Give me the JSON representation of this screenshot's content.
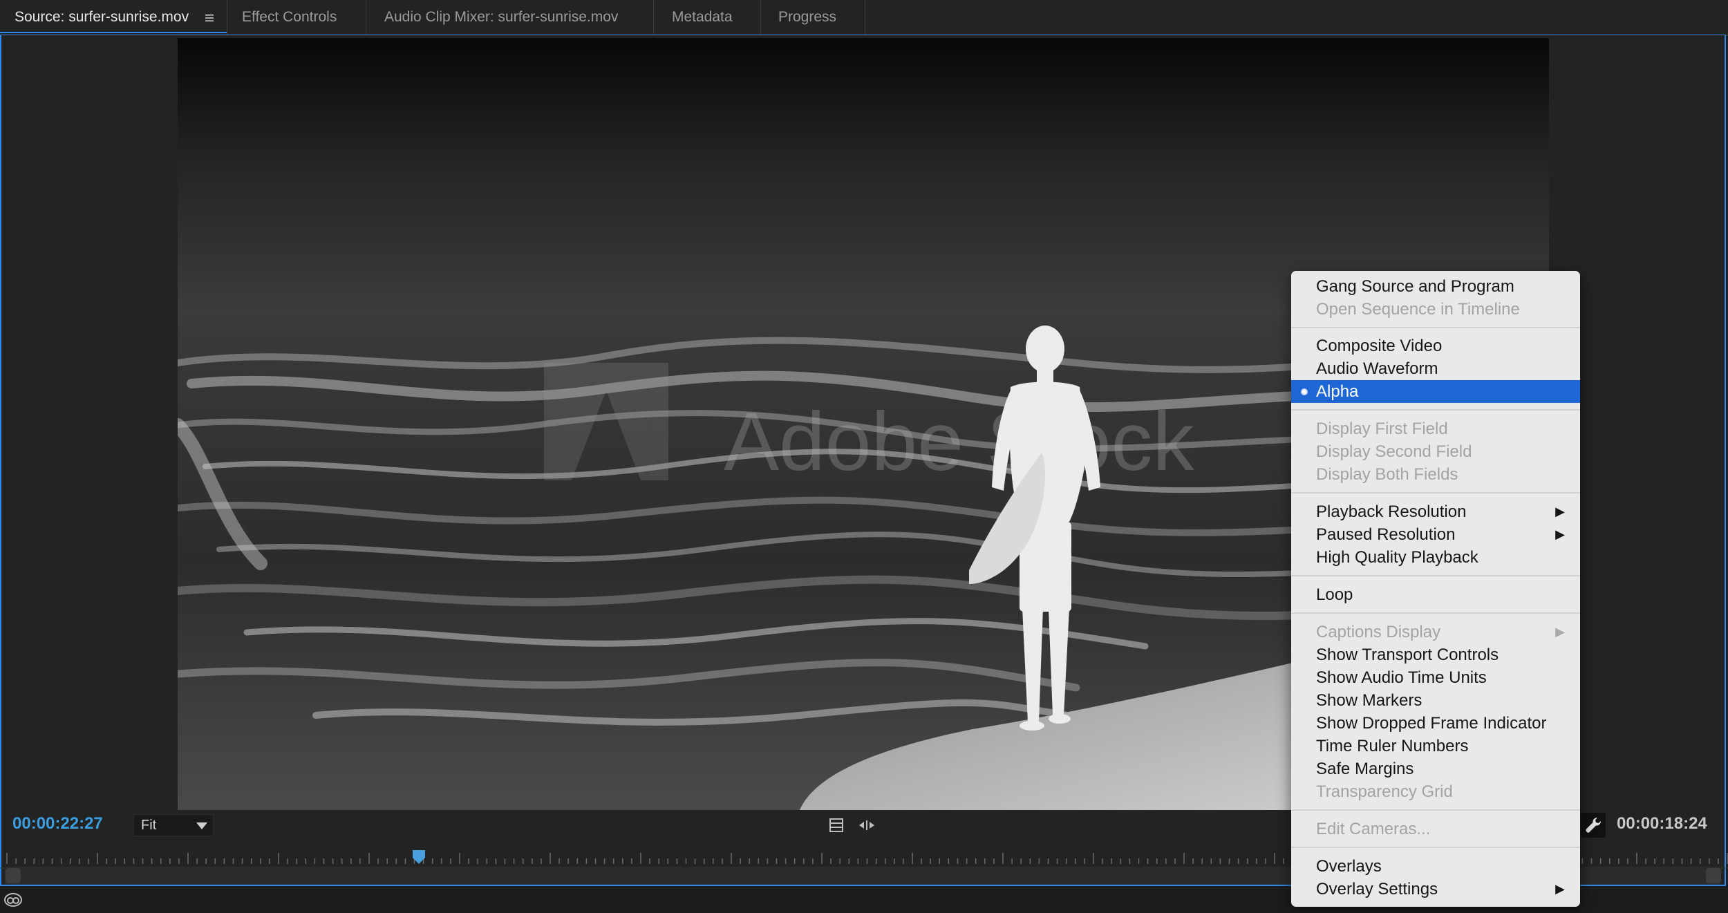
{
  "tabs": [
    {
      "label": "Source: surfer-sunrise.mov",
      "active": true
    },
    {
      "label": "Effect Controls",
      "active": false
    },
    {
      "label": "Audio Clip Mixer: surfer-sunrise.mov",
      "active": false
    },
    {
      "label": "Metadata",
      "active": false
    },
    {
      "label": "Progress",
      "active": false
    }
  ],
  "tab_menu_icon": "hamburger-menu-icon",
  "viewer": {
    "watermark": "Adobe Stock",
    "mode": "Alpha"
  },
  "controls": {
    "current_timecode": "00:00:22:27",
    "duration_timecode": "00:00:18:24",
    "zoom_value": "Fit",
    "icons": [
      "insert-frame-icon",
      "overwrite-arrows-icon",
      "wrench-icon"
    ],
    "playhead_color": "#4a9fde",
    "timecode_color": "#3a9ee0"
  },
  "context_menu": {
    "groups": [
      [
        {
          "label": "Gang Source and Program",
          "disabled": false
        },
        {
          "label": "Open Sequence in Timeline",
          "disabled": true
        }
      ],
      [
        {
          "label": "Composite Video",
          "disabled": false
        },
        {
          "label": "Audio Waveform",
          "disabled": false
        },
        {
          "label": "Alpha",
          "disabled": false,
          "selected": true
        }
      ],
      [
        {
          "label": "Display First Field",
          "disabled": true
        },
        {
          "label": "Display Second Field",
          "disabled": true
        },
        {
          "label": "Display Both Fields",
          "disabled": true
        }
      ],
      [
        {
          "label": "Playback Resolution",
          "disabled": false,
          "submenu": true
        },
        {
          "label": "Paused Resolution",
          "disabled": false,
          "submenu": true
        },
        {
          "label": "High Quality Playback",
          "disabled": false
        }
      ],
      [
        {
          "label": "Loop",
          "disabled": false
        }
      ],
      [
        {
          "label": "Captions Display",
          "disabled": true,
          "submenu": true
        },
        {
          "label": "Show Transport Controls",
          "disabled": false
        },
        {
          "label": "Show Audio Time Units",
          "disabled": false
        },
        {
          "label": "Show Markers",
          "disabled": false
        },
        {
          "label": "Show Dropped Frame Indicator",
          "disabled": false
        },
        {
          "label": "Time Ruler Numbers",
          "disabled": false
        },
        {
          "label": "Safe Margins",
          "disabled": false
        },
        {
          "label": "Transparency Grid",
          "disabled": true
        }
      ],
      [
        {
          "label": "Edit Cameras...",
          "disabled": true
        }
      ],
      [
        {
          "label": "Overlays",
          "disabled": false
        },
        {
          "label": "Overlay Settings",
          "disabled": false,
          "submenu": true
        }
      ]
    ],
    "selected_color": "#1e66d6"
  },
  "status_icon": "creative-cloud-sync-icon"
}
